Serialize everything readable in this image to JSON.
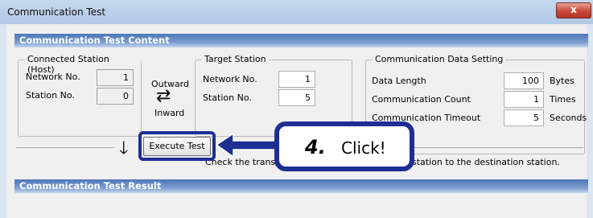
{
  "window": {
    "title": "Communication Test",
    "close_glyph": "x"
  },
  "content_section": {
    "title": "Communication Test Content"
  },
  "connected_station": {
    "legend": "Connected Station (Host)",
    "network_label": "Network No.",
    "network_value": "1",
    "station_label": "Station No.",
    "station_value": "0"
  },
  "direction": {
    "outward": "Outward",
    "inward": "Inward",
    "arrows_glyph": "⇄"
  },
  "target_station": {
    "legend": "Target Station",
    "network_label": "Network No.",
    "network_value": "1",
    "station_label": "Station No.",
    "station_value": "5"
  },
  "data_setting": {
    "legend": "Communication Data Setting",
    "length_label": "Data Length",
    "length_value": "100",
    "length_unit": "Bytes",
    "count_label": "Communication Count",
    "count_value": "1",
    "count_unit": "Times",
    "timeout_label": "Communication Timeout",
    "timeout_value": "5",
    "timeout_unit": "Seconds"
  },
  "execute": {
    "down_arrow_glyph": "🡓",
    "button_label": "Execute Test",
    "description_part1": "Check the transient communic",
    "description_part2": "station to the destination station."
  },
  "callout": {
    "step_number": "4.",
    "text": "Click!"
  },
  "result_section": {
    "title": "Communication Test Result"
  },
  "colors": {
    "accent": "#1d2f93",
    "section_bar": "#4b76b8"
  }
}
